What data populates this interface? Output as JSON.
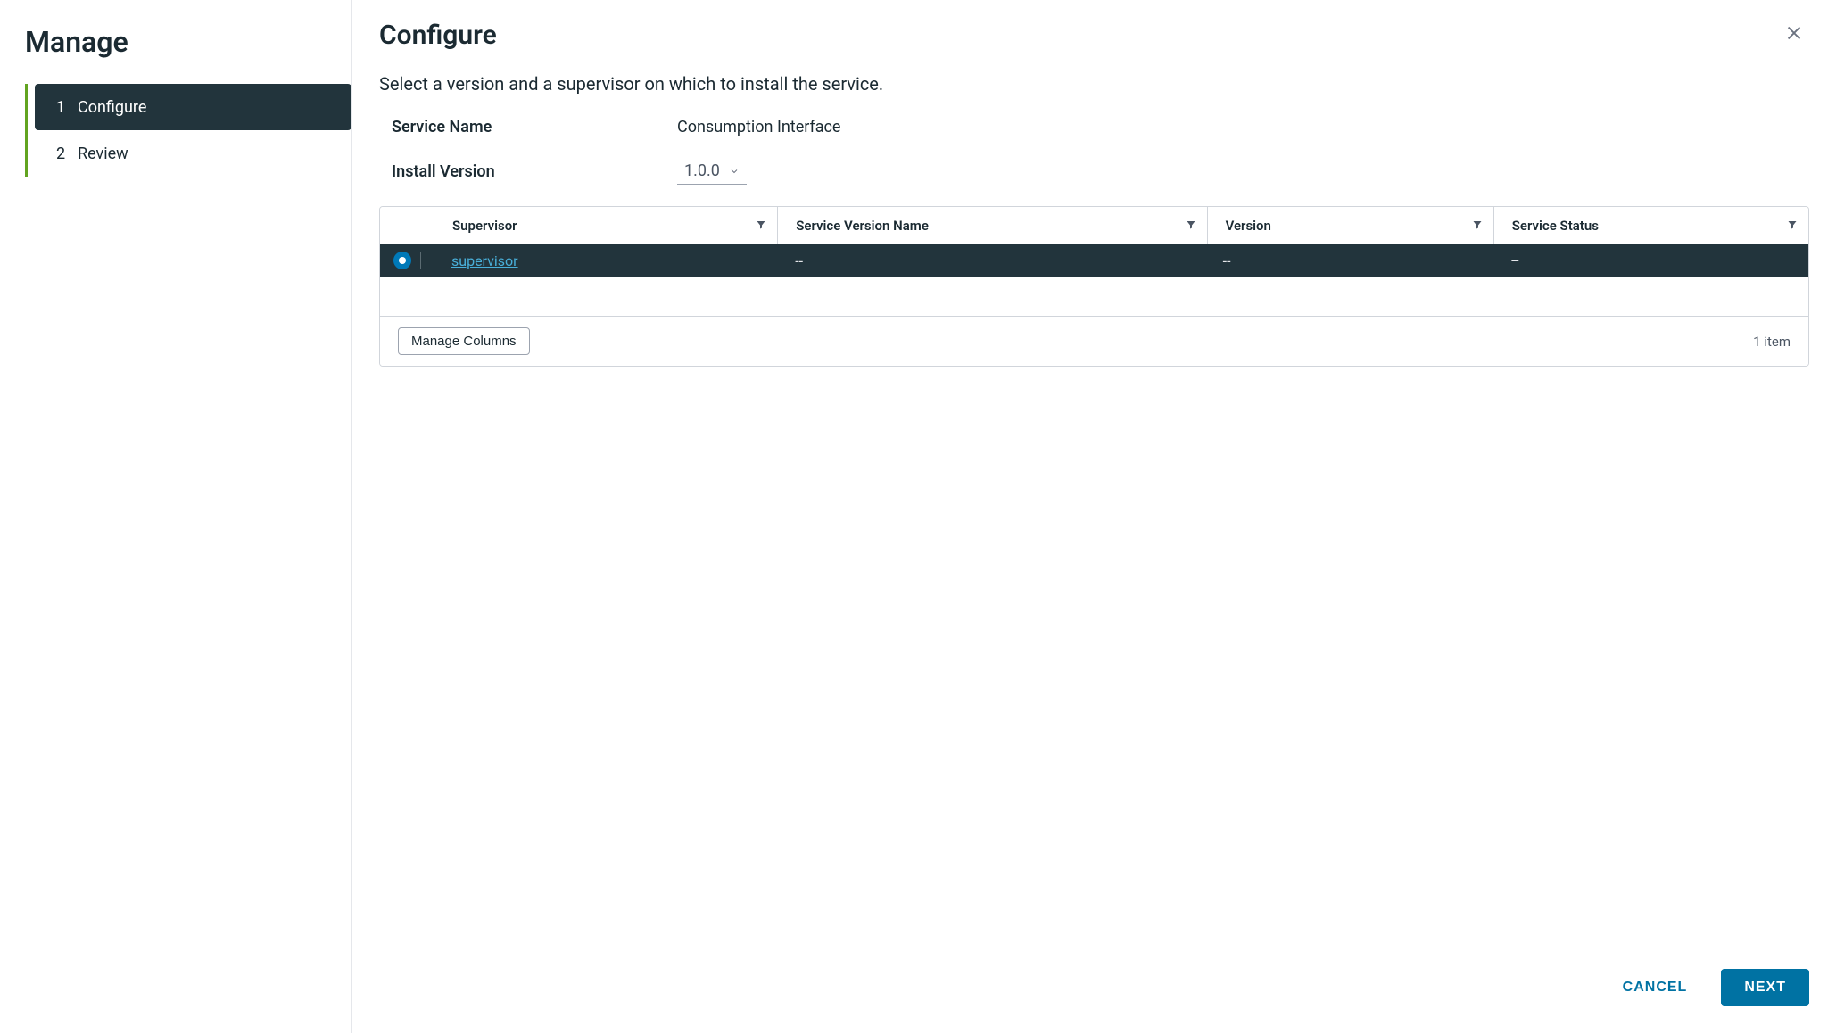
{
  "sidebar": {
    "title": "Manage",
    "steps": [
      {
        "num": "1",
        "label": "Configure",
        "active": true
      },
      {
        "num": "2",
        "label": "Review",
        "active": false
      }
    ]
  },
  "header": {
    "title": "Configure"
  },
  "subtitle": "Select a version and a supervisor on which to install the service.",
  "form": {
    "service_name_label": "Service Name",
    "service_name_value": "Consumption Interface",
    "install_version_label": "Install Version",
    "install_version_value": "1.0.0"
  },
  "table": {
    "columns": {
      "supervisor": "Supervisor",
      "service_version_name": "Service Version Name",
      "version": "Version",
      "service_status": "Service Status"
    },
    "rows": [
      {
        "selected": true,
        "supervisor": "supervisor",
        "service_version_name": "--",
        "version": "--",
        "service_status": "–"
      }
    ],
    "manage_columns_label": "Manage Columns",
    "item_count": "1 item"
  },
  "footer": {
    "cancel": "CANCEL",
    "next": "NEXT"
  }
}
